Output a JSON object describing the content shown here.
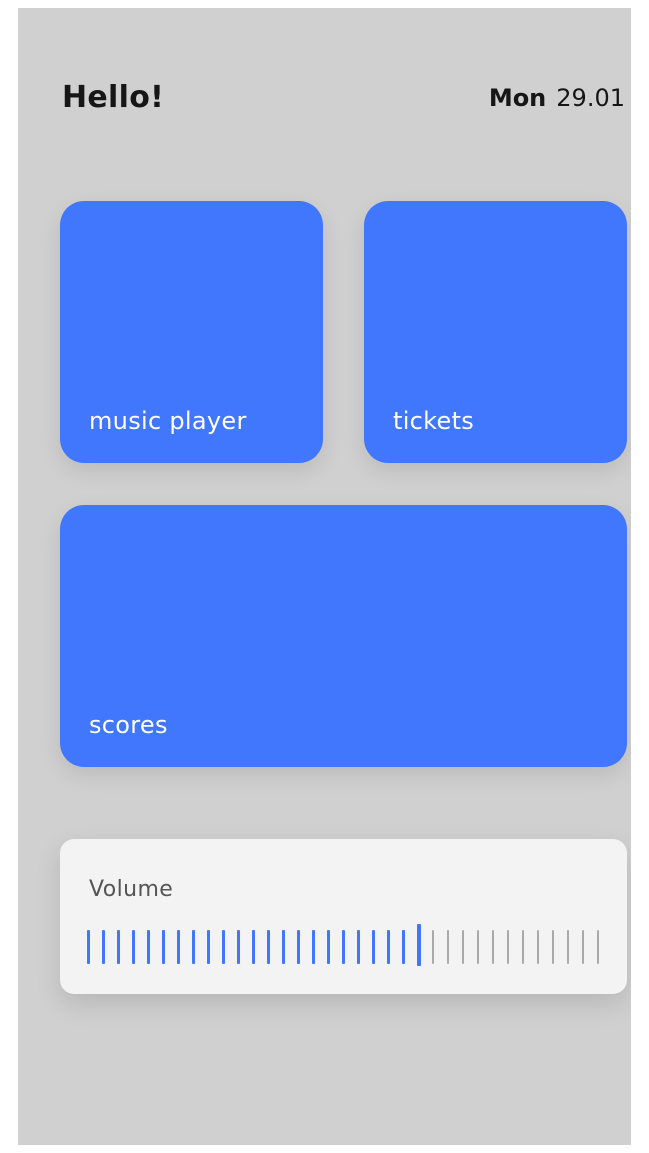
{
  "header": {
    "greeting": "Hello!",
    "day": "Mon",
    "date": "29.01"
  },
  "tiles": [
    {
      "label": "music player"
    },
    {
      "label": "tickets"
    },
    {
      "label": "scores"
    }
  ],
  "volume": {
    "label": "Volume",
    "level": 22,
    "total_ticks": 35
  },
  "colors": {
    "accent": "#4177fd",
    "tick_inactive": "#a9a9a9",
    "screen_background": "#d0d0d0",
    "card_background": "#f3f3f3"
  }
}
